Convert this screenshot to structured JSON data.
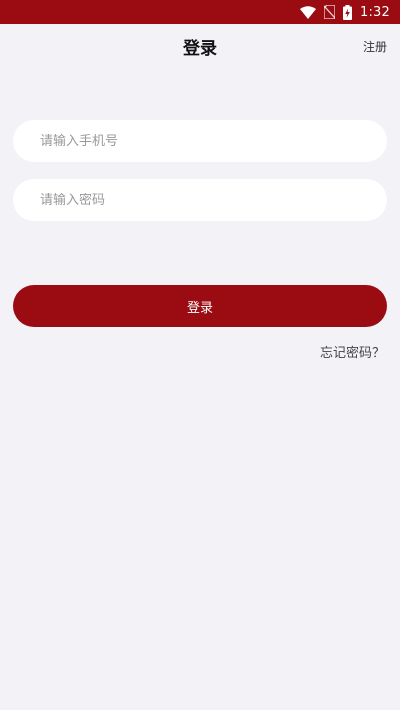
{
  "status_bar": {
    "time": "1:32",
    "icons": [
      "wifi-icon",
      "no-sim-icon",
      "battery-charging-icon"
    ],
    "background": "#9a0c12"
  },
  "header": {
    "title": "登录",
    "register_label": "注册"
  },
  "form": {
    "phone_placeholder": "请输入手机号",
    "password_placeholder": "请输入密码",
    "phone_value": "",
    "password_value": "",
    "login_label": "登录",
    "forgot_label": "忘记密码？"
  },
  "colors": {
    "accent": "#9a0c12",
    "background": "#f3f2f7",
    "input_background": "#ffffff"
  }
}
